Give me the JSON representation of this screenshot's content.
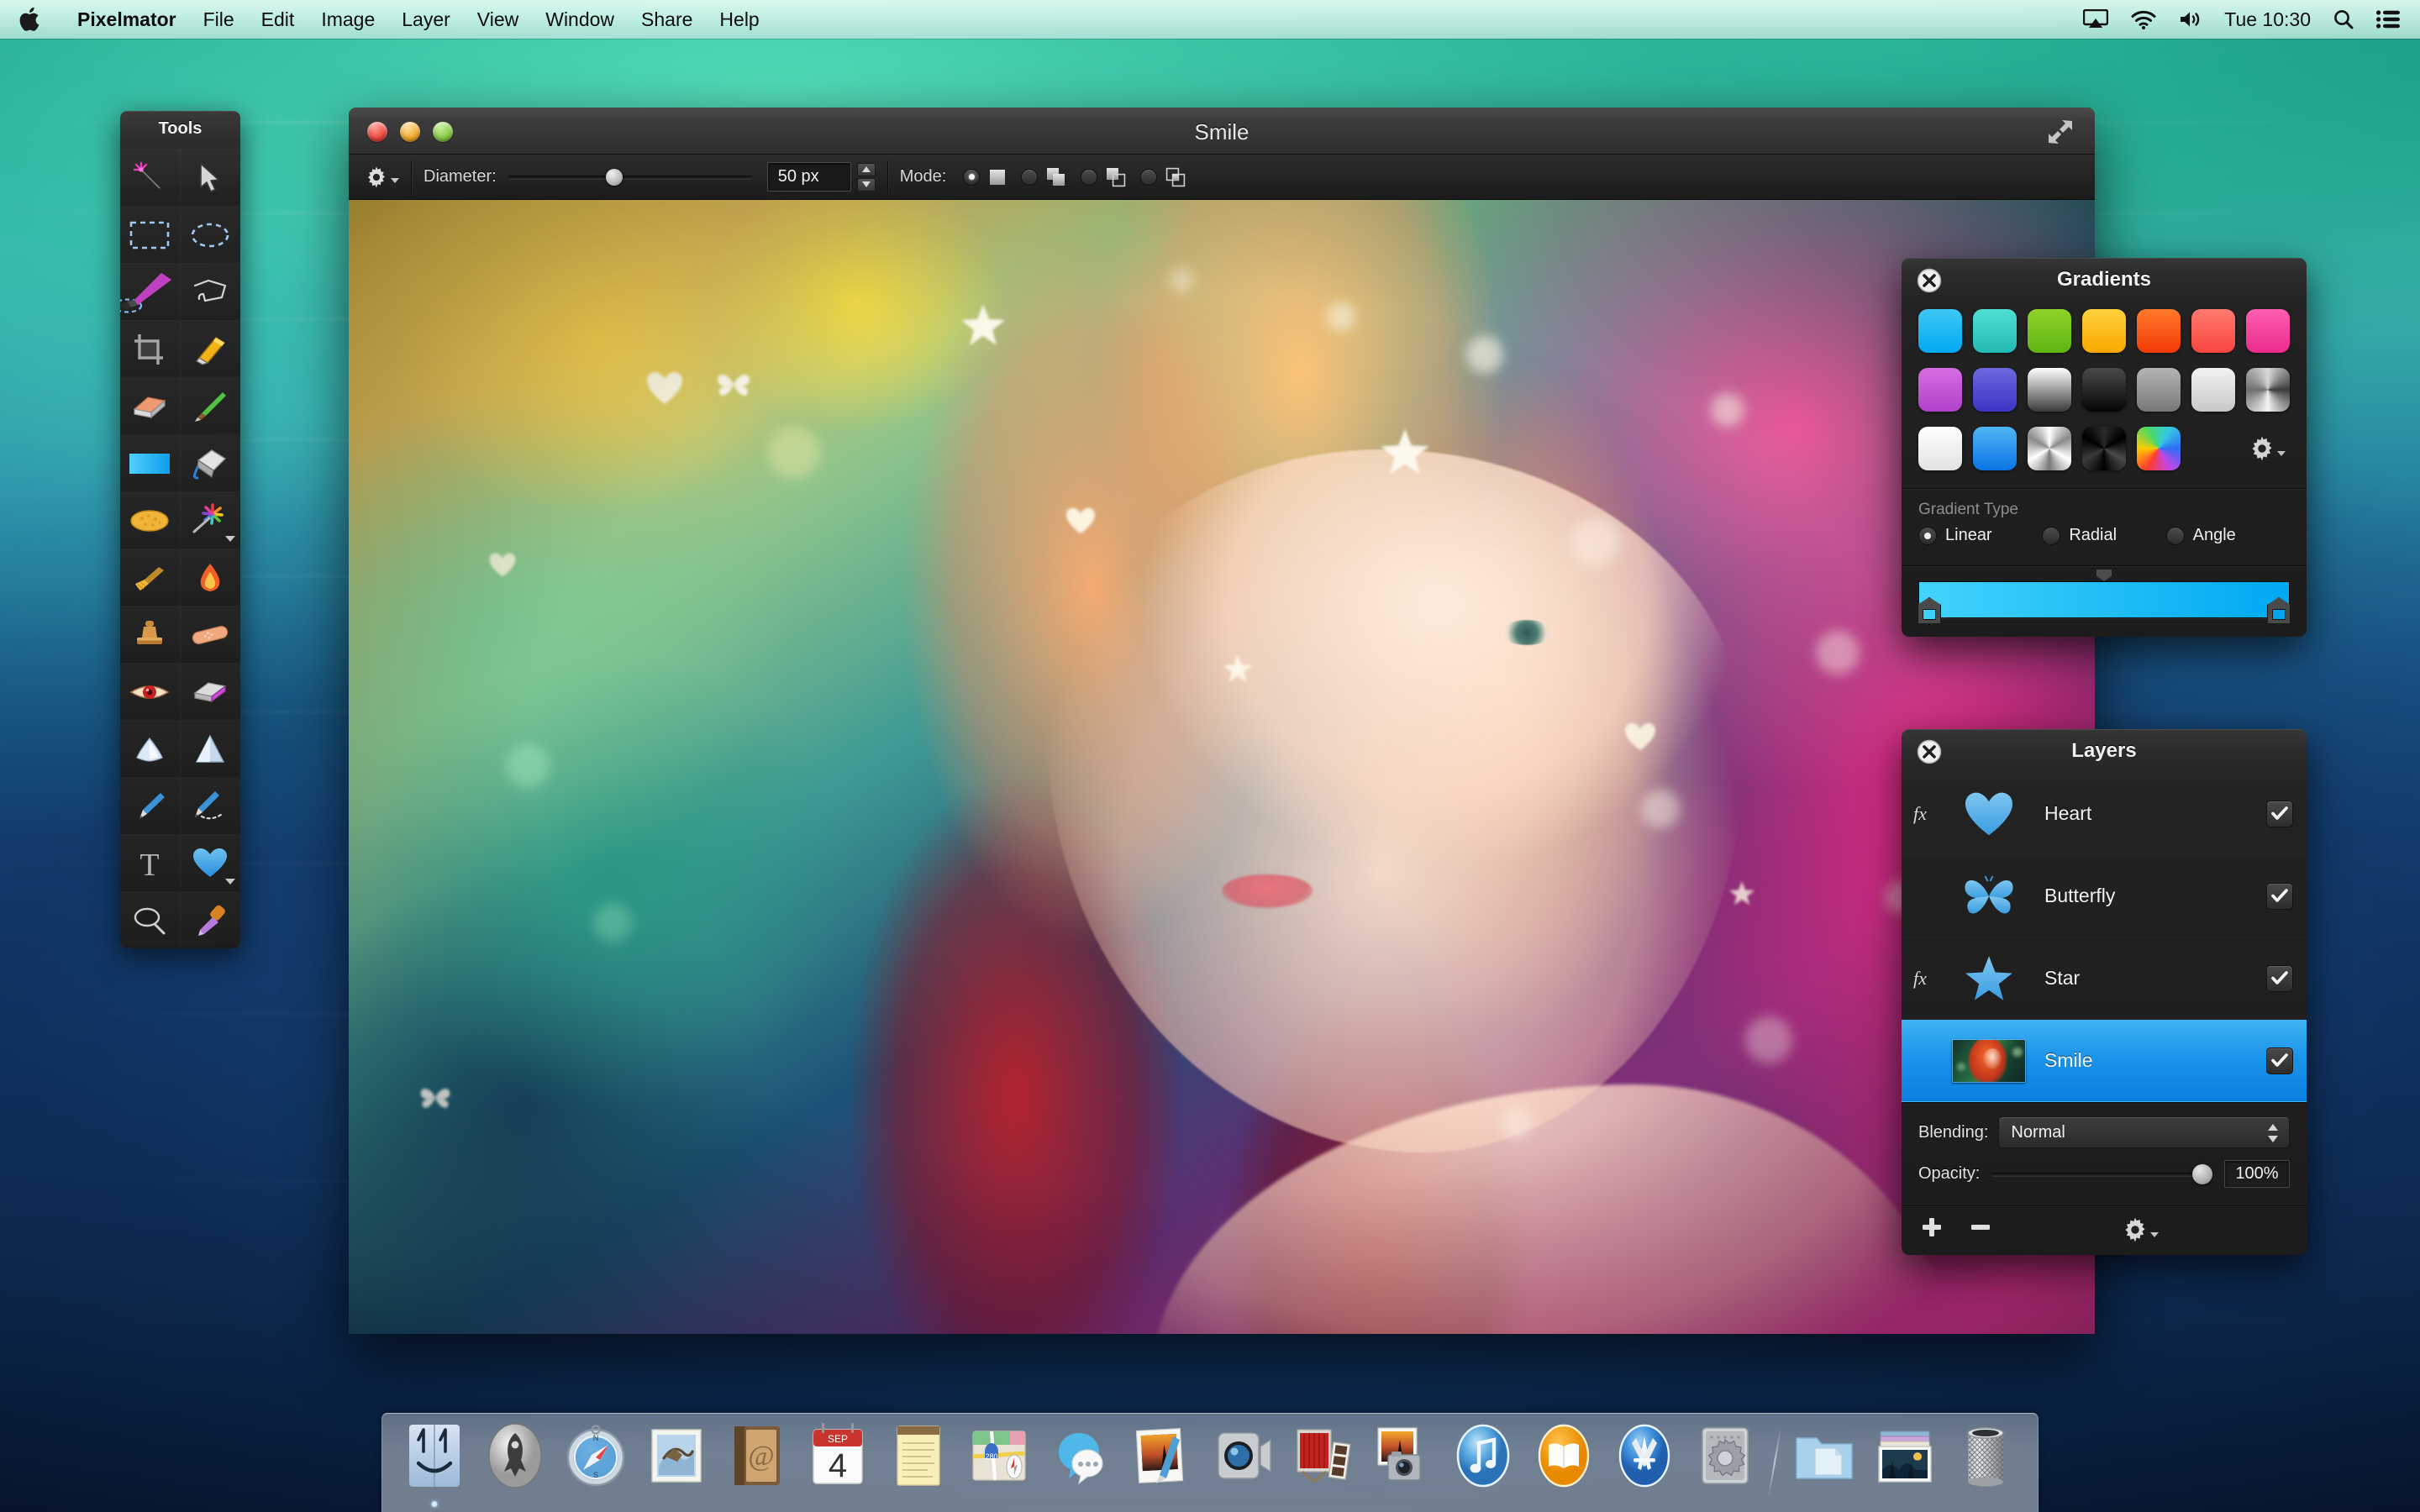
{
  "menubar": {
    "apple_icon": "apple-logo-icon",
    "items": [
      {
        "label": "Pixelmator",
        "bold": true
      },
      {
        "label": "File"
      },
      {
        "label": "Edit"
      },
      {
        "label": "Image"
      },
      {
        "label": "Layer"
      },
      {
        "label": "View"
      },
      {
        "label": "Window"
      },
      {
        "label": "Share"
      },
      {
        "label": "Help"
      }
    ],
    "status_icons": [
      "airplay-icon",
      "wifi-icon",
      "volume-icon"
    ],
    "clock": "Tue 10:30",
    "right_icons": [
      "search-icon",
      "notification-center-icon"
    ]
  },
  "tools": {
    "title": "Tools",
    "items": [
      {
        "name": "magic-wand-tool",
        "label": "Magic Wand"
      },
      {
        "name": "move-tool",
        "label": "Move"
      },
      {
        "name": "rectangular-marquee-tool",
        "label": "Rectangular Marquee"
      },
      {
        "name": "elliptical-marquee-tool",
        "label": "Elliptical Marquee"
      },
      {
        "name": "quick-selection-tool",
        "label": "Quick Selection",
        "selected": true
      },
      {
        "name": "polygonal-lasso-tool",
        "label": "Polygonal Lasso"
      },
      {
        "name": "crop-tool",
        "label": "Crop"
      },
      {
        "name": "slice-tool",
        "label": "Slice"
      },
      {
        "name": "eraser-tool",
        "label": "Eraser"
      },
      {
        "name": "paint-brush-tool",
        "label": "Paint Brush"
      },
      {
        "name": "gradient-tool",
        "label": "Gradient"
      },
      {
        "name": "paint-bucket-tool",
        "label": "Paint Bucket"
      },
      {
        "name": "sponge-tool",
        "label": "Sponge"
      },
      {
        "name": "effects-tool",
        "label": "Effects"
      },
      {
        "name": "smudge-tool",
        "label": "Smudge"
      },
      {
        "name": "burn-tool",
        "label": "Burn"
      },
      {
        "name": "clone-stamp-tool",
        "label": "Clone Stamp"
      },
      {
        "name": "repair-tool",
        "label": "Repair"
      },
      {
        "name": "red-eye-tool",
        "label": "Red Eye"
      },
      {
        "name": "color-replace-tool",
        "label": "Color Replace"
      },
      {
        "name": "blur-tool",
        "label": "Blur"
      },
      {
        "name": "sharpen-tool",
        "label": "Sharpen"
      },
      {
        "name": "pen-tool",
        "label": "Pen"
      },
      {
        "name": "freeform-pen-tool",
        "label": "Freeform Pen"
      },
      {
        "name": "type-tool",
        "label": "Type"
      },
      {
        "name": "shape-tool",
        "label": "Shape"
      },
      {
        "name": "zoom-tool",
        "label": "Zoom"
      },
      {
        "name": "color-picker-tool",
        "label": "Color Picker"
      }
    ]
  },
  "window": {
    "title": "Smile",
    "traffic_lights": [
      "close-button",
      "minimize-button",
      "zoom-button"
    ],
    "fullscreen_icon": "fullscreen-icon",
    "toolbar": {
      "gear_label": "gear-icon",
      "diameter_label": "Diameter:",
      "diameter_value": "50 px",
      "diameter_slider_percent": 40,
      "mode_label": "Mode:",
      "modes": [
        {
          "name": "mode-new-selection",
          "selected": true
        },
        {
          "name": "mode-add-selection",
          "selected": false
        },
        {
          "name": "mode-subtract-selection",
          "selected": false
        },
        {
          "name": "mode-intersect-selection",
          "selected": false
        }
      ]
    }
  },
  "gradients_panel": {
    "title": "Gradients",
    "close_icon": "close-icon",
    "gear_icon": "gear-icon",
    "swatches": [
      {
        "name": "gradient-sky-blue",
        "css": "linear-gradient(180deg,#3ec8f5,#00a8f0)"
      },
      {
        "name": "gradient-teal",
        "css": "linear-gradient(180deg,#4fe0d2,#21b9b4)"
      },
      {
        "name": "gradient-green",
        "css": "linear-gradient(180deg,#8fd32a,#5fb513)"
      },
      {
        "name": "gradient-yellow",
        "css": "linear-gradient(180deg,#ffd23d,#f9a700)"
      },
      {
        "name": "gradient-orange",
        "css": "linear-gradient(180deg,#ff7a2a,#f23a06)"
      },
      {
        "name": "gradient-red",
        "css": "linear-gradient(180deg,#ff7a6e,#f7463f)"
      },
      {
        "name": "gradient-pink",
        "css": "linear-gradient(180deg,#ff5fb0,#ea2b8c)"
      },
      {
        "name": "gradient-violet",
        "css": "linear-gradient(180deg,#d46fe0,#b040c8)"
      },
      {
        "name": "gradient-indigo",
        "css": "linear-gradient(180deg,#6a6ae0,#3b34c4)"
      },
      {
        "name": "gradient-white-to-black",
        "css": "linear-gradient(180deg,#ffffff,#3b3b3b)"
      },
      {
        "name": "gradient-black",
        "css": "linear-gradient(180deg,#4a4a4a,#050505)"
      },
      {
        "name": "gradient-gray",
        "css": "linear-gradient(180deg,#b4b4b4,#787878)"
      },
      {
        "name": "gradient-light-gray",
        "css": "linear-gradient(180deg,#f2f2f2,#c8c8c8)"
      },
      {
        "name": "gradient-angle-gray",
        "css": "conic-gradient(from 180deg,#f4f4f4,#6e6e6e,#d8d8d8,#3a3a3a)"
      },
      {
        "name": "gradient-white-transparent",
        "css": "linear-gradient(180deg,#ffffff,#e2e2e2)"
      },
      {
        "name": "gradient-blue",
        "css": "linear-gradient(180deg,#4fb6f5,#0a74e6)"
      },
      {
        "name": "gradient-metal-radial",
        "css": "conic-gradient(from 0deg,#ffffff,#8a8a8a,#ffffff,#777,#fff,#8a8a8a,#fff)"
      },
      {
        "name": "gradient-black-radial",
        "css": "conic-gradient(from 0deg,#2a2a2a,#000,#444,#000,#333,#000,#2a2a2a)"
      },
      {
        "name": "gradient-rainbow",
        "css": "conic-gradient(from 210deg,#ff3b30,#ffcc00,#4cd964,#34c7e6,#2f6df5,#c246e8,#ff3b30)"
      }
    ],
    "gradient_type_label": "Gradient Type",
    "gradient_types": [
      {
        "label": "Linear",
        "selected": true
      },
      {
        "label": "Radial",
        "selected": false
      },
      {
        "label": "Angle",
        "selected": false
      }
    ],
    "editor": {
      "bar_css": "linear-gradient(90deg,#43d3fb 0%,#00a9f2 100%)",
      "start_stop_color": "#3ed2fb",
      "end_stop_color": "#00a4f0",
      "midpoint_percent": 50
    }
  },
  "layers_panel": {
    "title": "Layers",
    "close_icon": "close-icon",
    "rows": [
      {
        "name": "Heart",
        "fx": "fx",
        "visible": true,
        "thumb": "heart-thumb",
        "selected": false
      },
      {
        "name": "Butterfly",
        "fx": "",
        "visible": true,
        "thumb": "butterfly-thumb",
        "selected": false
      },
      {
        "name": "Star",
        "fx": "fx",
        "visible": true,
        "thumb": "star-thumb",
        "selected": false
      },
      {
        "name": "Smile",
        "fx": "",
        "visible": true,
        "thumb": "photo-thumb",
        "selected": true
      }
    ],
    "blending_label": "Blending:",
    "blending_value": "Normal",
    "opacity_label": "Opacity:",
    "opacity_value": "100%",
    "opacity_percent": 100,
    "buttons": [
      {
        "name": "add-layer-button",
        "glyph": "+"
      },
      {
        "name": "remove-layer-button",
        "glyph": "−"
      },
      {
        "name": "layer-options-gear",
        "glyph": "gear-icon"
      }
    ]
  },
  "dock": {
    "items": [
      {
        "name": "finder",
        "label": "Finder",
        "running": true
      },
      {
        "name": "launchpad",
        "label": "Launchpad",
        "running": false
      },
      {
        "name": "safari",
        "label": "Safari",
        "running": false
      },
      {
        "name": "mail",
        "label": "Mail",
        "running": false
      },
      {
        "name": "contacts",
        "label": "Contacts",
        "running": false
      },
      {
        "name": "calendar",
        "label": "Calendar",
        "running": false,
        "month": "SEP",
        "day": "4"
      },
      {
        "name": "notes",
        "label": "Notes",
        "running": false
      },
      {
        "name": "maps",
        "label": "Maps",
        "running": false
      },
      {
        "name": "messages",
        "label": "Messages",
        "running": false
      },
      {
        "name": "photos",
        "label": "Photos",
        "running": false
      },
      {
        "name": "facetime",
        "label": "FaceTime",
        "running": false
      },
      {
        "name": "imovie",
        "label": "iMovie",
        "running": false
      },
      {
        "name": "iphoto",
        "label": "iPhoto",
        "running": false
      },
      {
        "name": "itunes",
        "label": "iTunes",
        "running": false
      },
      {
        "name": "ibooks",
        "label": "iBooks",
        "running": false
      },
      {
        "name": "app-store",
        "label": "App Store",
        "running": false
      },
      {
        "name": "system-preferences",
        "label": "System Preferences",
        "running": false
      },
      {
        "name": "documents-folder",
        "label": "Documents",
        "running": false,
        "after_separator": true
      },
      {
        "name": "pictures-stack",
        "label": "Pictures",
        "running": false
      },
      {
        "name": "trash",
        "label": "Trash",
        "running": false
      }
    ]
  }
}
